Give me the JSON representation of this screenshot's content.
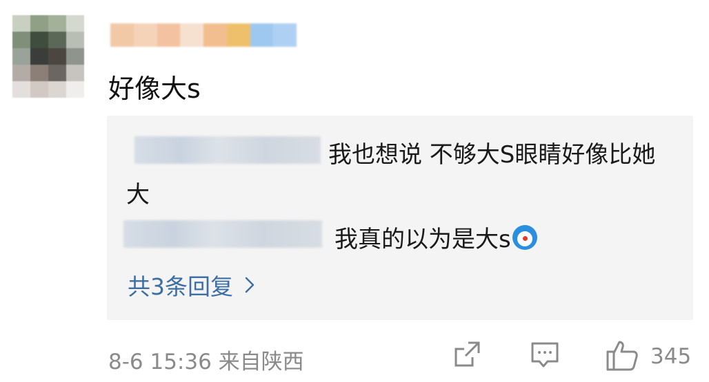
{
  "comment": {
    "text": "好像大s",
    "meta": "8-6 15:36 来自陕西",
    "like_count": "345"
  },
  "replies": [
    {
      "text": "我也想说 不够大S眼睛好像比她大"
    },
    {
      "text": "我真的以为是大s",
      "emoji": "doraemon-emoji"
    }
  ],
  "more_replies_label": "共3条回复",
  "colors": {
    "link": "#3d6ea3",
    "meta": "#8a8a8a",
    "reply_bg": "#f4f4f4",
    "name_blur": [
      "#f1c9a6",
      "#f5d3b8",
      "#f3c2a0",
      "#f6e0cf",
      "#f2be8f",
      "#efc06b",
      "#9ec8f0",
      "#aed1f3"
    ]
  }
}
